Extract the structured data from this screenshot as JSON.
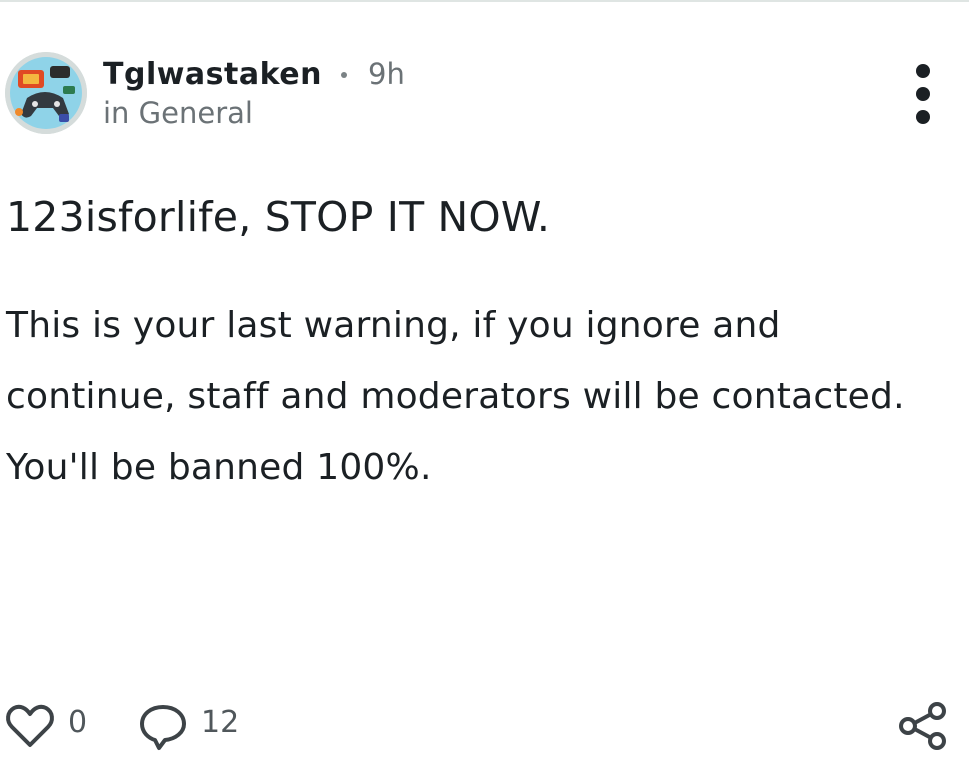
{
  "post": {
    "author": "Tglwastaken",
    "separator": "•",
    "time": "9h",
    "community": "in General",
    "title": "123isforlife, STOP IT NOW.",
    "body": "This is your last warning, if you ignore and continue, staff and moderators will be contacted. You'll be banned 100%.",
    "likes": "0",
    "comments": "12"
  },
  "icons": {
    "menu": "more-vertical-icon",
    "like": "heart-icon",
    "comment": "comment-bubble-icon",
    "share": "share-icon"
  },
  "colors": {
    "text": "#1b2024",
    "muted": "#6b7276",
    "avatar_bg": "#d5dcdb"
  }
}
